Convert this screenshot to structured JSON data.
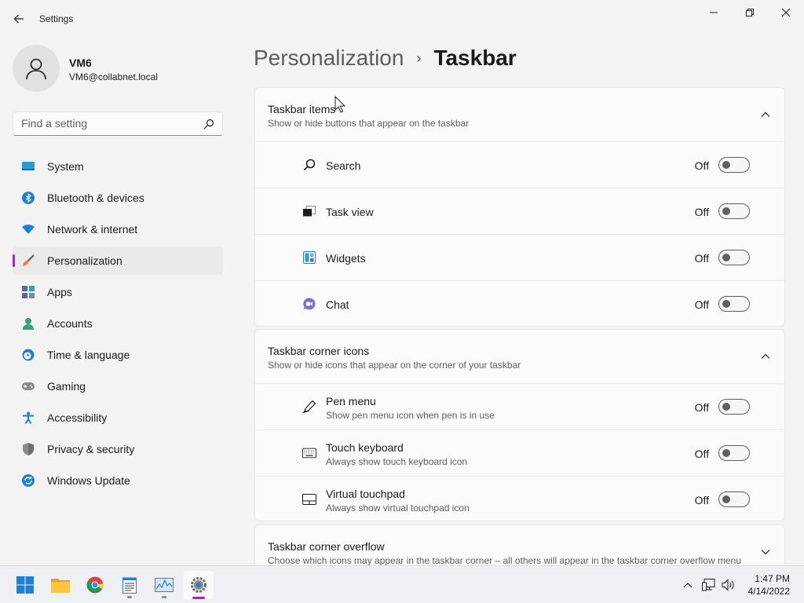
{
  "window": {
    "title": "Settings"
  },
  "profile": {
    "name": "VM6",
    "email": "VM6@collabnet.local"
  },
  "search": {
    "placeholder": "Find a setting"
  },
  "nav": {
    "items": [
      {
        "label": "System",
        "icon": "system-icon"
      },
      {
        "label": "Bluetooth & devices",
        "icon": "bluetooth-icon"
      },
      {
        "label": "Network & internet",
        "icon": "wifi-icon"
      },
      {
        "label": "Personalization",
        "icon": "brush-icon",
        "selected": true
      },
      {
        "label": "Apps",
        "icon": "apps-icon"
      },
      {
        "label": "Accounts",
        "icon": "person-icon"
      },
      {
        "label": "Time & language",
        "icon": "clock-globe-icon"
      },
      {
        "label": "Gaming",
        "icon": "gamepad-icon"
      },
      {
        "label": "Accessibility",
        "icon": "accessibility-icon"
      },
      {
        "label": "Privacy & security",
        "icon": "shield-icon"
      },
      {
        "label": "Windows Update",
        "icon": "update-icon"
      }
    ]
  },
  "breadcrumb": {
    "parent": "Personalization",
    "separator": "›",
    "current": "Taskbar"
  },
  "sections": {
    "items": {
      "title": "Taskbar items",
      "subtitle": "Show or hide buttons that appear on the taskbar",
      "rows": [
        {
          "label": "Search",
          "state": "Off",
          "icon": "search-icon"
        },
        {
          "label": "Task view",
          "state": "Off",
          "icon": "task-view-icon"
        },
        {
          "label": "Widgets",
          "state": "Off",
          "icon": "widgets-icon"
        },
        {
          "label": "Chat",
          "state": "Off",
          "icon": "chat-icon"
        }
      ]
    },
    "corner": {
      "title": "Taskbar corner icons",
      "subtitle": "Show or hide icons that appear on the corner of your taskbar",
      "rows": [
        {
          "label": "Pen menu",
          "description": "Show pen menu icon when pen is in use",
          "state": "Off",
          "icon": "pen-icon"
        },
        {
          "label": "Touch keyboard",
          "description": "Always show touch keyboard icon",
          "state": "Off",
          "icon": "keyboard-icon"
        },
        {
          "label": "Virtual touchpad",
          "description": "Always show virtual touchpad icon",
          "state": "Off",
          "icon": "touchpad-icon"
        }
      ]
    },
    "overflow": {
      "title": "Taskbar corner overflow",
      "subtitle": "Choose which icons may appear in the taskbar corner – all others will appear in the taskbar corner overflow menu"
    }
  },
  "taskbar": {
    "apps": [
      "windows-start-icon",
      "file-explorer-icon",
      "chrome-icon",
      "notepad-icon",
      "performance-monitor-icon",
      "settings-gear-icon"
    ],
    "tray": [
      "chevron-up-icon",
      "network-icon",
      "volume-icon"
    ],
    "time": "1:47 PM",
    "date": "4/14/2022"
  },
  "colors": {
    "accent": "#9b2fa5",
    "background": "#f3f3f3",
    "card": "#fbfbfb"
  }
}
